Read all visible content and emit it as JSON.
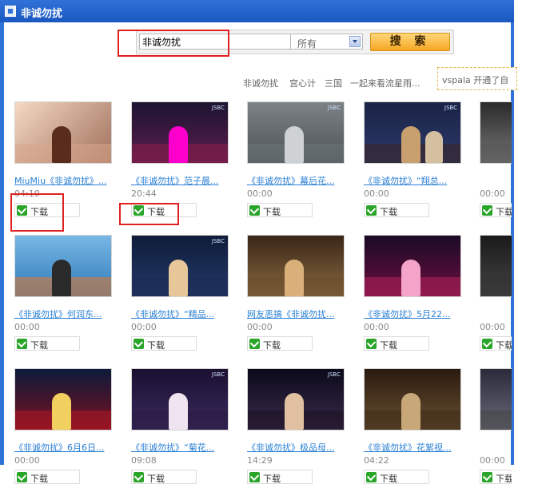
{
  "window": {
    "title": "非诚勿扰"
  },
  "search": {
    "query": "非诚勿扰",
    "scope": "所有",
    "button": "搜 索"
  },
  "hot_keywords": [
    "非诚勿扰",
    "宫心计",
    "三国",
    "一起来看流星雨..."
  ],
  "notice": "vspala 开通了自",
  "download_label": "下载",
  "videos": [
    {
      "title": "MiuMiu《非诚勿扰》...",
      "duration": "04:10"
    },
    {
      "title": "《非诚勿扰》范子晨...",
      "duration": "20:44"
    },
    {
      "title": "《非诚勿扰》幕后花...",
      "duration": "00:00"
    },
    {
      "title": "《非诚勿扰》“翔总...",
      "duration": "00:00"
    },
    {
      "title": "",
      "duration": "00:00"
    },
    {
      "title": "《非诚勿扰》何润东...",
      "duration": "00:00"
    },
    {
      "title": "《非诚勿扰》“精品...",
      "duration": "00:00"
    },
    {
      "title": "网友恶搞《非诚勿扰...",
      "duration": "00:00"
    },
    {
      "title": "《非诚勿扰》5月22...",
      "duration": "00:00"
    },
    {
      "title": "",
      "duration": "00:00"
    },
    {
      "title": "《非诚勿扰》6月6日...",
      "duration": "00:00"
    },
    {
      "title": "《非诚勿扰》“菊花...",
      "duration": "09:08"
    },
    {
      "title": "《非诚勿扰》极品母...",
      "duration": "14:29"
    },
    {
      "title": "《非诚勿扰》花絮视...",
      "duration": "04:22"
    },
    {
      "title": "",
      "duration": "00:00"
    }
  ]
}
